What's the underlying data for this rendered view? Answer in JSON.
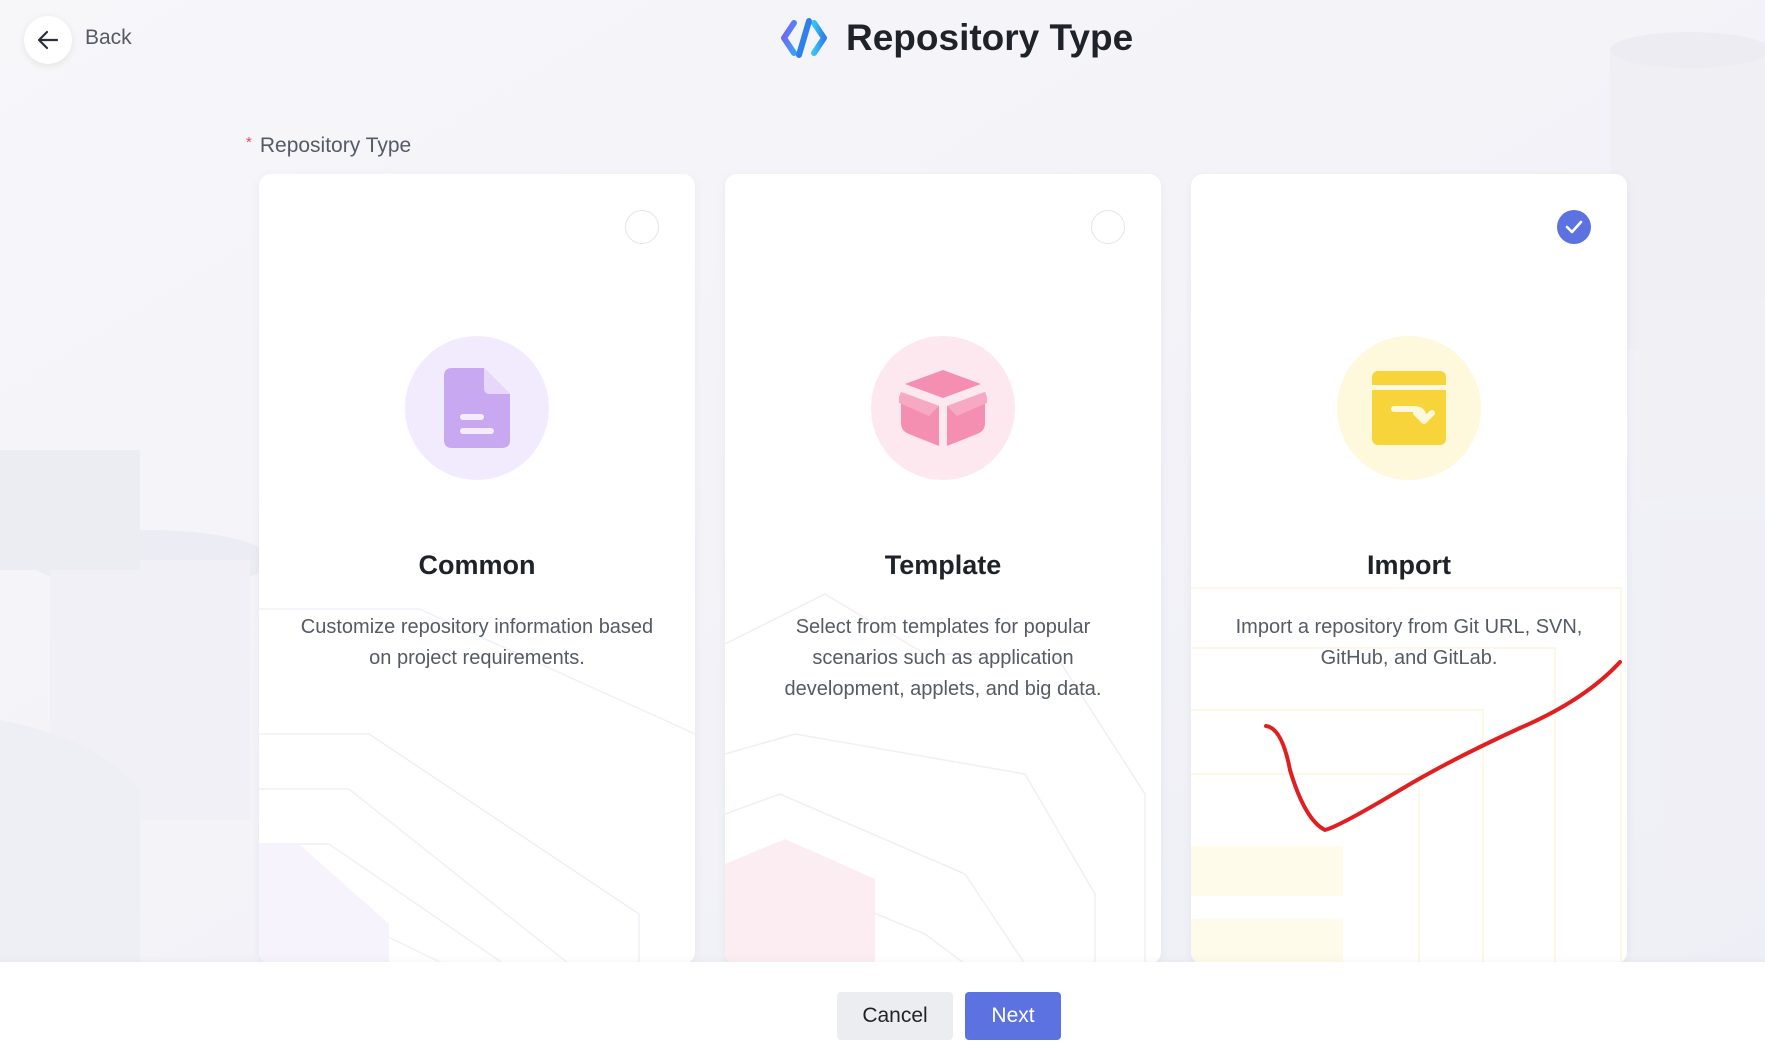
{
  "header": {
    "back_label": "Back",
    "title": "Repository Type"
  },
  "form": {
    "field_label": "Repository Type",
    "required_mark": "*",
    "selected": "import"
  },
  "cards": [
    {
      "id": "common",
      "title": "Common",
      "description": "Customize repository information based on project requirements.",
      "icon": "document-icon",
      "accent": "#c9a8f2",
      "circle_bg": "#f2ebfd",
      "selected": false
    },
    {
      "id": "template",
      "title": "Template",
      "description": "Select from templates for popular scenarios such as application development, applets, and big data.",
      "icon": "package-icon",
      "accent": "#f48fb1",
      "circle_bg": "#fde8ef",
      "selected": false
    },
    {
      "id": "import",
      "title": "Import",
      "description": "Import a repository from Git URL, SVN, GitHub, and GitLab.",
      "icon": "import-box-icon",
      "accent": "#f7d43a",
      "circle_bg": "#fef8dc",
      "selected": true
    }
  ],
  "footer": {
    "cancel_label": "Cancel",
    "next_label": "Next"
  },
  "colors": {
    "primary": "#5b72e0",
    "required": "#e34d59",
    "annotation": "#e02020"
  }
}
